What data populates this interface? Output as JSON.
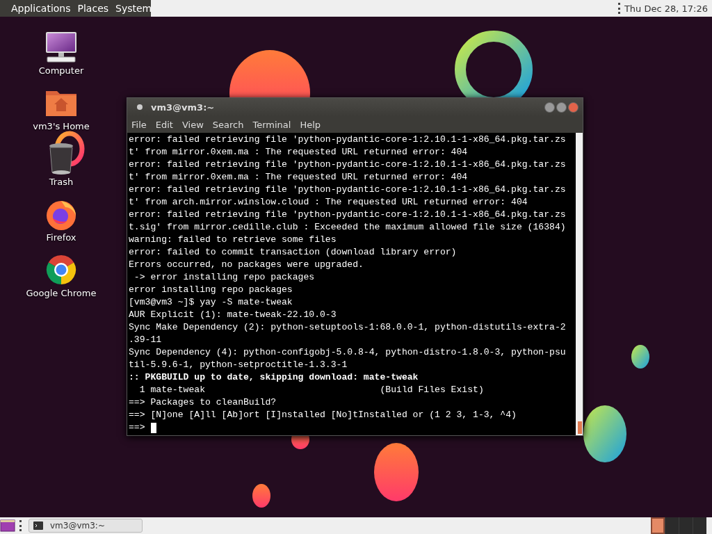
{
  "top_panel": {
    "menus": [
      "Applications",
      "Places",
      "System"
    ],
    "clock": "Thu Dec 28, 17:26"
  },
  "desktop_icons": [
    {
      "label": "Computer",
      "kind": "computer"
    },
    {
      "label": "vm3's Home",
      "kind": "home"
    },
    {
      "label": "Trash",
      "kind": "trash"
    },
    {
      "label": "Firefox",
      "kind": "firefox"
    },
    {
      "label": "Google Chrome",
      "kind": "chrome"
    }
  ],
  "terminal": {
    "title": "vm3@vm3:~",
    "menu": [
      "File",
      "Edit",
      "View",
      "Search",
      "Terminal",
      "Help"
    ],
    "lines": [
      {
        "text": "error: failed retrieving file 'python-pydantic-core-1:2.10.1-1-x86_64.pkg.tar.zs",
        "kind": "normal"
      },
      {
        "text": "t' from mirror.0xem.ma : The requested URL returned error: 404",
        "kind": "normal"
      },
      {
        "text": "error: failed retrieving file 'python-pydantic-core-1:2.10.1-1-x86_64.pkg.tar.zs",
        "kind": "normal"
      },
      {
        "text": "t' from mirror.0xem.ma : The requested URL returned error: 404",
        "kind": "normal"
      },
      {
        "text": "error: failed retrieving file 'python-pydantic-core-1:2.10.1-1-x86_64.pkg.tar.zs",
        "kind": "normal"
      },
      {
        "text": "t' from arch.mirror.winslow.cloud : The requested URL returned error: 404",
        "kind": "normal"
      },
      {
        "text": "error: failed retrieving file 'python-pydantic-core-1:2.10.1-1-x86_64.pkg.tar.zs",
        "kind": "normal"
      },
      {
        "text": "t.sig' from mirror.cedille.club : Exceeded the maximum allowed file size (16384)",
        "kind": "normal"
      },
      {
        "text": "warning: failed to retrieve some files",
        "kind": "normal"
      },
      {
        "text": "error: failed to commit transaction (download library error)",
        "kind": "normal"
      },
      {
        "text": "Errors occurred, no packages were upgraded.",
        "kind": "normal"
      },
      {
        "text": " -> error installing repo packages",
        "kind": "normal"
      },
      {
        "text": "error installing repo packages",
        "kind": "normal"
      },
      {
        "text": "[vm3@vm3 ~]$ yay -S mate-tweak",
        "kind": "normal"
      },
      {
        "text": "AUR Explicit (1): mate-tweak-22.10.0-3",
        "kind": "normal"
      },
      {
        "text": "Sync Make Dependency (2): python-setuptools-1:68.0.0-1, python-distutils-extra-2",
        "kind": "normal"
      },
      {
        "text": ".39-11",
        "kind": "normal"
      },
      {
        "text": "Sync Dependency (4): python-configobj-5.0.8-4, python-distro-1.8.0-3, python-psu",
        "kind": "normal"
      },
      {
        "text": "til-5.9.6-1, python-setproctitle-1.3.3-1",
        "kind": "normal"
      },
      {
        "text": ":: PKGBUILD up to date, skipping download: mate-tweak",
        "kind": "bold"
      },
      {
        "text": "  1 mate-tweak                                (Build Files Exist)",
        "kind": "normal"
      },
      {
        "text": "==> Packages to cleanBuild?",
        "kind": "normal"
      },
      {
        "text": "==> [N]one [A]ll [Ab]ort [I]nstalled [No]tInstalled or (1 2 3, 1-3, ^4)",
        "kind": "normal"
      },
      {
        "text": "==>",
        "kind": "prompt"
      }
    ]
  },
  "bottom_panel": {
    "taskbar_items": [
      {
        "label": "vm3@vm3:~"
      }
    ],
    "workspaces": [
      {
        "selected": true
      },
      {
        "selected": false
      },
      {
        "selected": false
      },
      {
        "selected": false
      }
    ]
  }
}
